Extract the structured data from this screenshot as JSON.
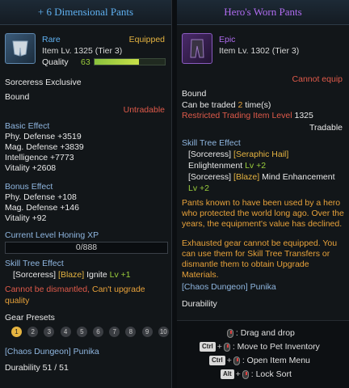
{
  "left": {
    "title": "+ 6 Dimensional Pants",
    "rarity": "Rare",
    "status": "Equipped",
    "item_level": "Item Lv. 1325 (Tier 3)",
    "quality_label": "Quality",
    "quality_value": "63",
    "quality_fraction": 0.63,
    "class_exclusive": "Sorceress Exclusive",
    "bound": "Bound",
    "untradable": "Untradable",
    "basic_effect": {
      "title": "Basic Effect",
      "lines": [
        "Phy. Defense +3519",
        "Mag. Defense +3839",
        "Intelligence +7773",
        "Vitality +2608"
      ]
    },
    "bonus_effect": {
      "title": "Bonus Effect",
      "lines": [
        "Phy. Defense +108",
        "Mag. Defense +146",
        "Vitality +92"
      ]
    },
    "honing": {
      "title": "Current Level Honing XP",
      "value": "0/888"
    },
    "skill_tree": {
      "title": "Skill Tree Effect",
      "class": "[Sorceress]",
      "tag": "[Blaze]",
      "skill": "Ignite",
      "level": "Lv +1"
    },
    "warning_line1_red": "Cannot be dismantled,",
    "warning_line1_orange": "Can't upgrade",
    "warning_line2_orange": "quality",
    "gear_presets": {
      "title": "Gear Presets",
      "items": [
        "1",
        "2",
        "3",
        "4",
        "5",
        "6",
        "7",
        "8",
        "9",
        "10"
      ],
      "active_index": 0
    },
    "source": "[Chaos Dungeon] Punika",
    "durability": "Durability 51 / 51"
  },
  "right": {
    "title": "Hero's Worn Pants",
    "rarity": "Epic",
    "item_level": "Item Lv. 1302 (Tier 3)",
    "cannot_equip": "Cannot equip",
    "bound": "Bound",
    "trade_prefix": "Can be traded",
    "trade_count": "2",
    "trade_suffix": "time(s)",
    "restricted_label": "Restricted Trading Item Level",
    "restricted_value": "1325",
    "tradable": "Tradable",
    "skill_tree": {
      "title": "Skill Tree Effect",
      "l1_class": "[Sorceress]",
      "l1_skill": "[Seraphic Hail]",
      "l2_text": "Enlightenment",
      "l2_level": "Lv +2",
      "l3_class": "[Sorceress]",
      "l3_tag": "[Blaze]",
      "l3_text": "Mind Enhancement",
      "l4_level": "Lv +2"
    },
    "lore": [
      "Pants known to have been used by a hero",
      "who protected the world long ago. Over the",
      "years, the equipment's value has declined."
    ],
    "exhausted": [
      "Exhausted gear cannot be equipped. You",
      "can use them for Skill Tree Transfers or",
      "dismantle them to obtain Upgrade",
      "Materials."
    ],
    "source": "[Chaos Dungeon] Punika",
    "durability": "Durability",
    "hints": [
      {
        "keys": [],
        "text": ": Drag and drop"
      },
      {
        "keys": [
          "Ctrl"
        ],
        "text": ": Move to Pet Inventory"
      },
      {
        "keys": [
          "Ctrl"
        ],
        "text": ": Open Item Menu"
      },
      {
        "keys": [
          "Alt"
        ],
        "text": ": Lock Sort"
      }
    ]
  },
  "colors": {
    "rare": "#5fb0f0",
    "epic": "#b06cf0",
    "equipped": "#e6b441",
    "red": "#e05a4a",
    "green": "#9ccf3c",
    "orange": "#e8a23a"
  }
}
